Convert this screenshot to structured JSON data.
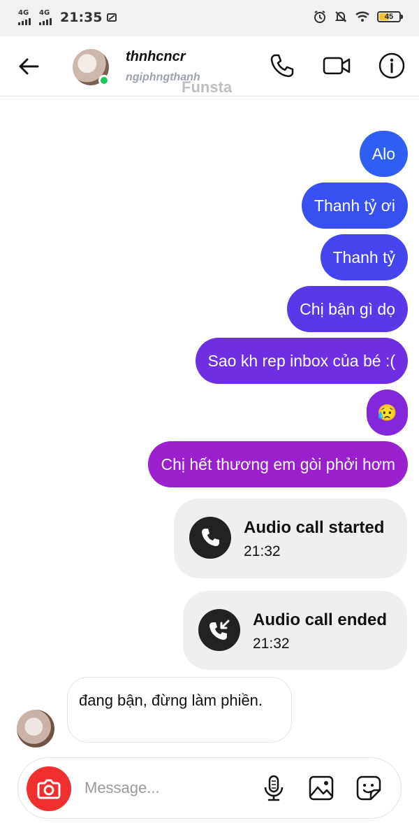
{
  "status_bar": {
    "net1": "4G",
    "net2": "4G",
    "time": "21:35",
    "battery": "45"
  },
  "header": {
    "name": "thnhcncr",
    "handle": "ngiphngthanh",
    "watermark": "Funsta"
  },
  "messages_out": [
    {
      "text": "Alo"
    },
    {
      "text": "Thanh tỷ ơi"
    },
    {
      "text": "Thanh tỷ"
    },
    {
      "text": "Chị bận gì dọ"
    },
    {
      "text": "Sao kh rep inbox của bé :("
    },
    {
      "text": "😥"
    },
    {
      "text": "Chị hết thương em gòi phởi hơm"
    }
  ],
  "calls": [
    {
      "title": "Audio call started",
      "time": "21:32",
      "icon": "phone-icon"
    },
    {
      "title": "Audio call ended",
      "time": "21:32",
      "icon": "phone-incoming-icon"
    }
  ],
  "message_in": {
    "text": "đang bận, đừng làm phiền."
  },
  "composer": {
    "placeholder": "Message..."
  },
  "colors": {
    "gradient_top": "#2F5BF0",
    "gradient_bottom": "#A11FC9",
    "call_bg": "#EFEFEF",
    "camera_red": "#EF2E2E",
    "online_green": "#22C55E"
  }
}
